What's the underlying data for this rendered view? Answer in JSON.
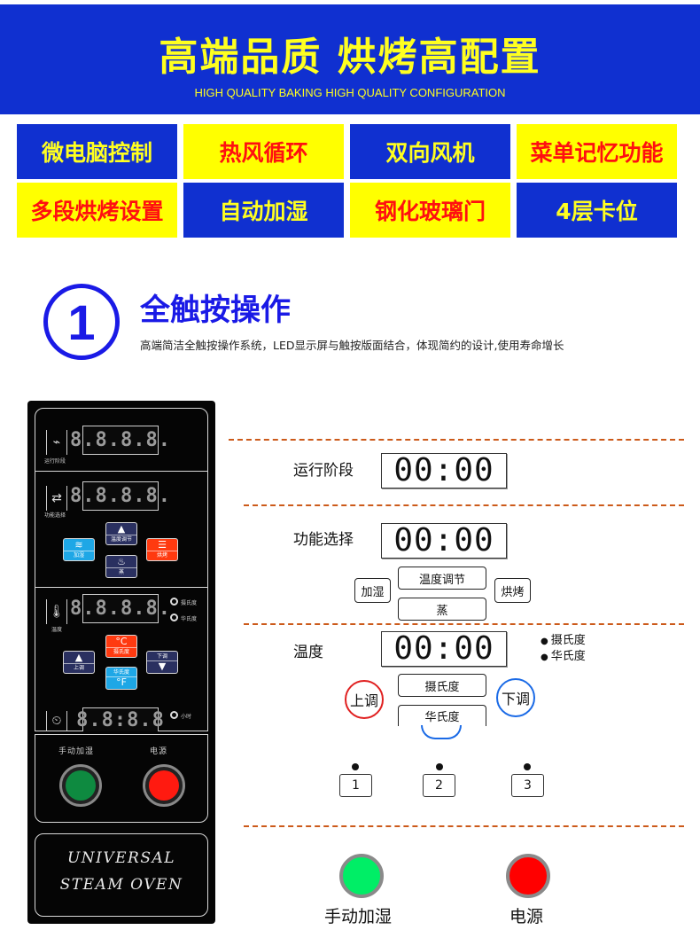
{
  "banner": {
    "title": "高端品质 烘烤高配置",
    "subtitle": "HIGH QUALITY BAKING HIGH QUALITY CONFIGURATION"
  },
  "features": [
    {
      "label": "微电脑控制",
      "style": "blue"
    },
    {
      "label": "热风循环",
      "style": "yellow"
    },
    {
      "label": "双向风机",
      "style": "blue"
    },
    {
      "label": "菜单记忆功能",
      "style": "yellow"
    },
    {
      "label": "多段烘烤设置",
      "style": "yellow"
    },
    {
      "label": "自动加湿",
      "style": "blue"
    },
    {
      "label": "钢化玻璃门",
      "style": "yellow"
    },
    {
      "label": "4层卡位",
      "style": "blue"
    }
  ],
  "section": {
    "number": "1",
    "title": "全触按操作",
    "description": "高端简洁全触按操作系统，LED显示屏与触按版面结合，体现简约的设计,使用寿命增长"
  },
  "panel": {
    "run_stage_label": "运行阶段",
    "function_select_label": "功能选择",
    "temperature_label": "温度",
    "led_display": "8.8.8.8.",
    "timer_display": "8.8:8.8",
    "buttons": {
      "humidify": "加湿",
      "temp_adjust": "温度调节",
      "steam": "蒸",
      "bake": "烘烤",
      "up": "上调",
      "down": "下调",
      "celsius": "摄氏度",
      "celsius_symbol": "°C",
      "fahrenheit": "华氏度",
      "fahrenheit_symbol": "°F"
    },
    "indicators": {
      "celsius": "摄氏度",
      "fahrenheit": "华氏度",
      "hour": "小时"
    },
    "manual_humidify_label": "手动加湿",
    "power_label": "电源",
    "brand_line1": "UNIVERSAL",
    "brand_line2": "STEAM OVEN"
  },
  "diagram": {
    "run_stage": {
      "label": "运行阶段",
      "display": "00:00"
    },
    "function_select": {
      "label": "功能选择",
      "display": "00:00",
      "buttons": {
        "humidify": "加湿",
        "temp_adjust": "温度调节",
        "steam": "蒸",
        "bake": "烘烤"
      }
    },
    "temperature": {
      "label": "温度",
      "display": "00:00",
      "units": [
        "摄氏度",
        "华氏度"
      ],
      "buttons": {
        "up": "上调",
        "down": "下调",
        "celsius": "摄氏度",
        "fahrenheit": "华氏度"
      }
    },
    "presets": [
      "1",
      "2",
      "3"
    ],
    "lamps": {
      "manual_humidify": {
        "label": "手动加湿",
        "color": "#00ee66"
      },
      "power": {
        "label": "电源",
        "color": "#ff0000"
      }
    }
  },
  "colors": {
    "banner_blue": "#1030d0",
    "banner_yellow": "#ffff20",
    "feature_red": "#ff1010",
    "section_blue": "#1a1ae6",
    "dash_orange": "#cc5a1a"
  }
}
